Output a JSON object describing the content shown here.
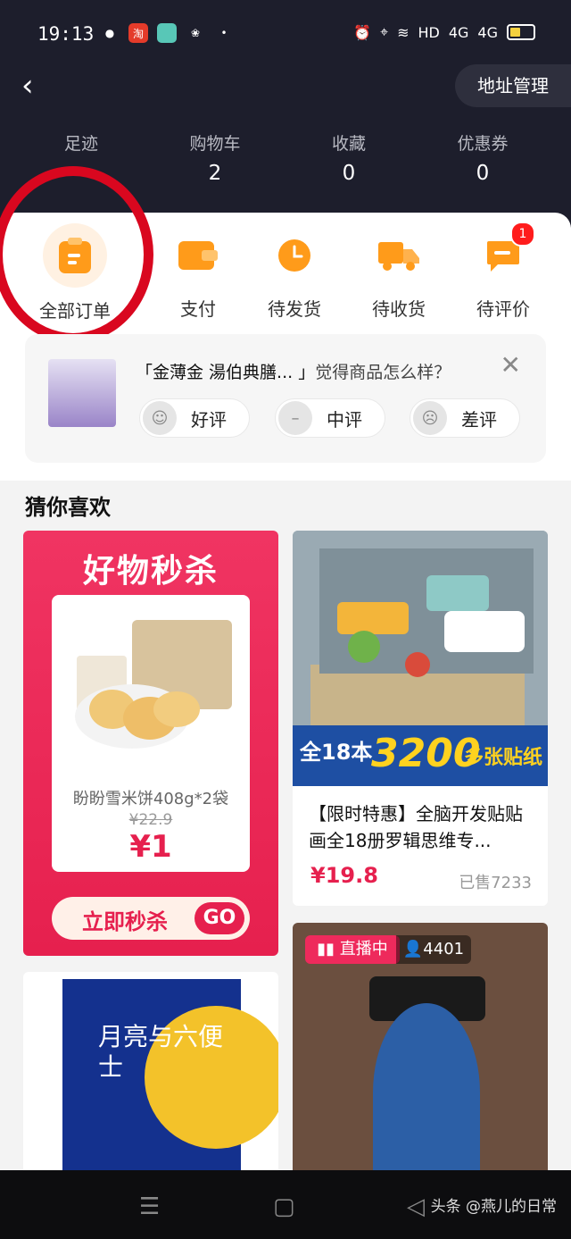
{
  "status_bar": {
    "time": "19:13",
    "network": "HD",
    "signal1": "4G",
    "signal2": "4G",
    "left_icons": [
      "wechat-icon",
      "taobao-icon",
      "app-icon",
      "squirrel-icon",
      "dot-icon"
    ],
    "right_icons": [
      "alarm-icon",
      "location-icon",
      "wifi-icon",
      "signal-icon",
      "battery-icon"
    ]
  },
  "header": {
    "back_icon": "‹",
    "address_button": "地址管理"
  },
  "stats": [
    {
      "label": "足迹",
      "value": ""
    },
    {
      "label": "购物车",
      "value": "2"
    },
    {
      "label": "收藏",
      "value": "0"
    },
    {
      "label": "优惠券",
      "value": "0"
    }
  ],
  "orders": [
    {
      "label": "全部订单",
      "icon": "clipboard-icon"
    },
    {
      "label": "支付",
      "icon": "wallet-icon"
    },
    {
      "label": "待发货",
      "icon": "clock-icon"
    },
    {
      "label": "待收货",
      "icon": "truck-icon"
    },
    {
      "label": "待评价",
      "icon": "comment-icon",
      "badge": "1"
    }
  ],
  "review": {
    "product_name": "「金薄金 湯伯典膳... 」",
    "question": "觉得商品怎么样？",
    "close": "✕",
    "buttons": [
      "好评",
      "中评",
      "差评"
    ]
  },
  "section_title": "猜你喜欢",
  "flash_sale": {
    "header": "好物秒杀",
    "product_name": "盼盼雪米饼408g*2袋",
    "old_price": "¥22.9",
    "price": "¥1",
    "button": "立即秒杀",
    "go": "GO"
  },
  "product1": {
    "banner_left": "全18本",
    "banner_mid": "3200",
    "banner_right": "多张贴纸",
    "title": "【限时特惠】全脑开发贴贴画全18册罗辑思维专...",
    "price": "¥19.8",
    "sold": "已售7233"
  },
  "product2": {
    "book_title": "月亮与六便士"
  },
  "product3": {
    "live_label": "直播中",
    "viewers": "4401"
  },
  "navbar": {
    "menu_icon": "☰",
    "home_icon": "▢",
    "back_icon": "◁",
    "watermark": "头条 @燕儿的日常"
  },
  "colors": {
    "dark_bg": "#1d1e2c",
    "accent_red": "#e6204e",
    "orange": "#ff9b1a",
    "annotation_red": "#d9071f"
  }
}
